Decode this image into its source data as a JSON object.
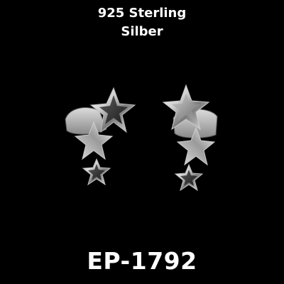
{
  "caption": {
    "line1": "925 Sterling",
    "line2": "Silber"
  },
  "product_code": "EP-1792",
  "colors": {
    "background": "#000000",
    "text": "#ffffff",
    "silver_light": "#f2f2f2",
    "silver_dark": "#6f6f6f"
  },
  "icons": [
    "star-earring-left",
    "star-earring-right"
  ]
}
